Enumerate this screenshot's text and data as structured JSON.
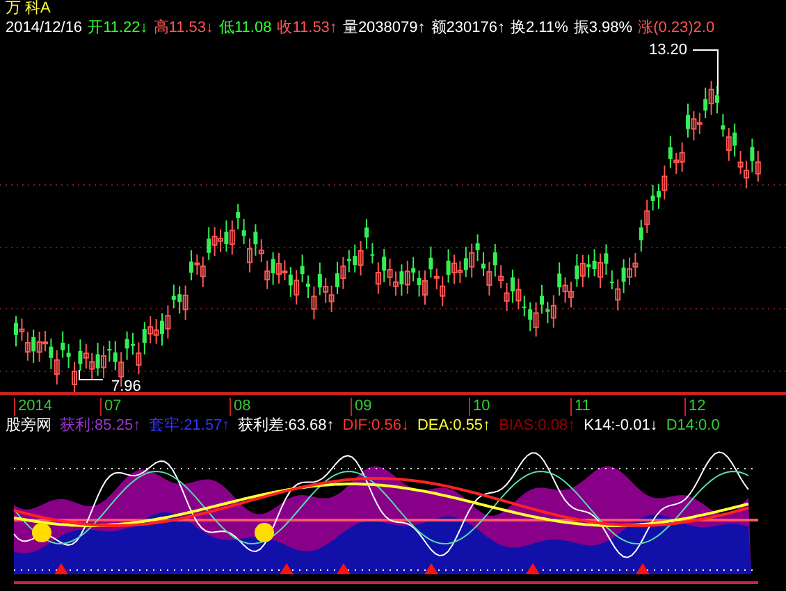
{
  "stock": {
    "name": "万 科A"
  },
  "quote": [
    {
      "text": "2014/12/16",
      "color": "#ffffff"
    },
    {
      "text": "开11.22↓",
      "color": "#33ff33"
    },
    {
      "text": "高11.53↓",
      "color": "#ff5555"
    },
    {
      "text": "低11.08",
      "color": "#33ff33"
    },
    {
      "text": "收11.53↑",
      "color": "#ff5555"
    },
    {
      "text": "量2038079↑",
      "color": "#ffffff"
    },
    {
      "text": "额230176↑",
      "color": "#ffffff"
    },
    {
      "text": "换2.11%",
      "color": "#ffffff"
    },
    {
      "text": "振3.98%",
      "color": "#ffffff"
    },
    {
      "text": "涨(0.23)2.0",
      "color": "#ff5555"
    }
  ],
  "price_chart": {
    "high_label": "13.20",
    "low_label": "7.96"
  },
  "x_axis": [
    "2014",
    "07",
    "08",
    "09",
    "10",
    "11",
    "12"
  ],
  "indicator": {
    "name": "股旁网",
    "legend": [
      {
        "text": "获利:85.25↑",
        "color": "#9933cc"
      },
      {
        "text": "套牢:21.57↑",
        "color": "#3333ff"
      },
      {
        "text": "获利差:63.68↑",
        "color": "#ffffff"
      },
      {
        "text": "DIF:0.56↓",
        "color": "#ff3333"
      },
      {
        "text": "DEA:0.55↑",
        "color": "#ffff33"
      },
      {
        "text": "BIAS:0.08↑",
        "color": "#990000"
      },
      {
        "text": "K14:-0.01↓",
        "color": "#ffffff"
      },
      {
        "text": "D14:0.0",
        "color": "#33cc33"
      }
    ]
  }
}
